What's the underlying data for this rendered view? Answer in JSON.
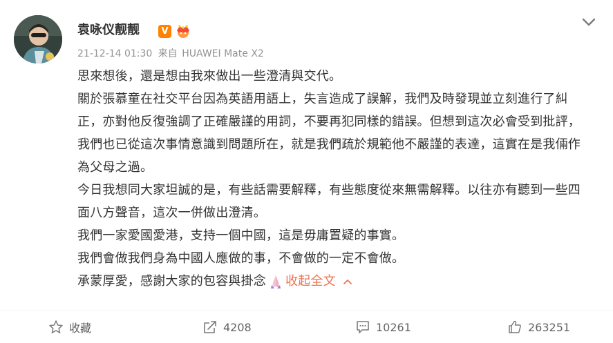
{
  "author": {
    "name": "袁咏仪靓靓",
    "verified_badge": "V",
    "badge_icon": "crown-icon"
  },
  "meta": {
    "timestamp": "21-12-14 01:30",
    "source_prefix": "来自",
    "device": "HUAWEI Mate X2"
  },
  "post": {
    "paragraphs": [
      "思來想後，還是想由我來做出一些澄清與交代。",
      "關於張慕童在社交平台因為英語用語上，失言造成了誤解，我們及時發現並立刻進行了糾正，亦對他反復強調了正確嚴謹的用詞，不要再犯同樣的錯誤。但想到這次必會受到批評，我們也已從這次事情意識到問題所在，就是我們疏於規範他不嚴謹的表達，這實在是我倆作為父母之過。",
      "今日我想同大家坦誠的是，有些話需要解釋，有些態度從來無需解釋。以往亦有聽到一些四面八方聲音，這次一併做出澄清。",
      "我們一家愛國愛港，支持一個中國，這是毋庸置疑的事實。",
      "我們會做我們身為中國人應做的事，不會做的一定不會做。"
    ],
    "last_line": "承蒙厚愛，感謝大家的包容與掛念",
    "emoji_icon": "praying-hands-emoji",
    "collapse_label": "收起全文"
  },
  "actions": {
    "favorite_label": "收藏",
    "repost_count": "4208",
    "comment_count": "10261",
    "like_count": "263251"
  },
  "colors": {
    "accent": "#eb7350",
    "verified": "#ff8200",
    "meta_text": "#939393"
  }
}
